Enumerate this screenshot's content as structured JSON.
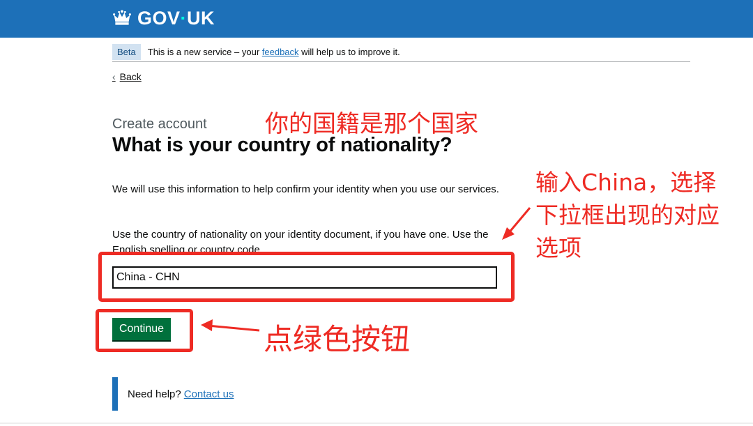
{
  "header": {
    "logo_text_a": "GOV",
    "logo_text_b": "UK",
    "logo_icon": "crown-icon"
  },
  "phase_banner": {
    "tag": "Beta",
    "text_before": "This is a new service – your ",
    "link": "feedback",
    "text_after": " will help us to improve it."
  },
  "back_link": {
    "label": "Back",
    "icon": "chevron-left-icon"
  },
  "main": {
    "caption": "Create account",
    "heading": "What is your country of nationality?",
    "paragraph1": "We will use this information to help confirm your identity when you use our services.",
    "paragraph2": "Use the country of nationality on your identity document, if you have one. Use the English spelling or country code.",
    "input_value": "China - CHN",
    "continue_button": "Continue"
  },
  "help": {
    "text": "Need help?",
    "link": "Contact us"
  },
  "annotations": {
    "heading_note": "你的国籍是那个国家",
    "input_note_line1": "输入China，选择",
    "input_note_line2": "下拉框出现的对应",
    "input_note_line3": "选项",
    "button_note": "点绿色按钮",
    "color": "#ee2b24"
  },
  "colors": {
    "govuk_blue": "#1d70b8",
    "button_green": "#00703c",
    "link_blue": "#1d70b8",
    "annotation_red": "#ee2b24"
  }
}
